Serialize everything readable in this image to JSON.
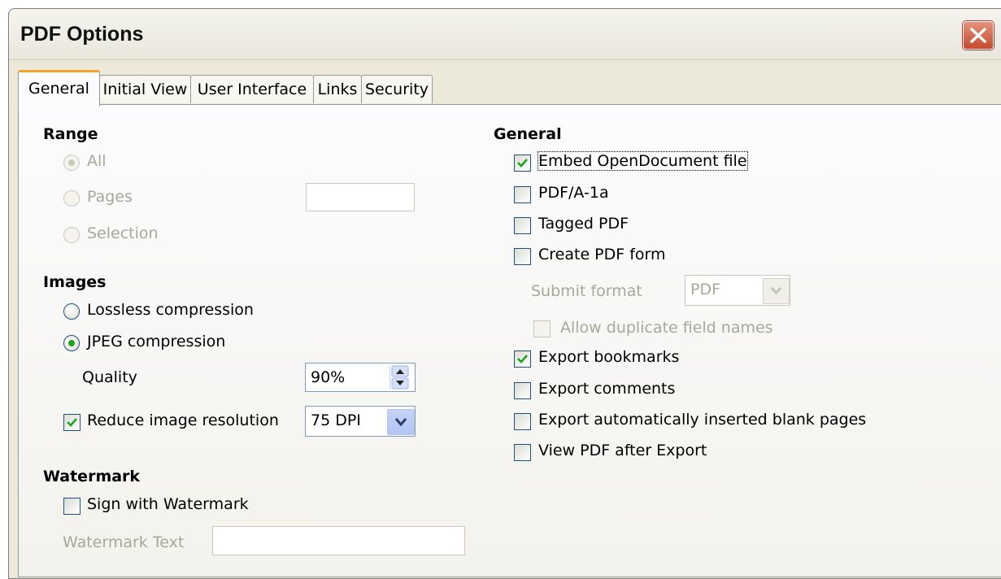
{
  "window": {
    "title": "PDF Options",
    "close_icon": "close-icon"
  },
  "tabs": [
    {
      "label": "General",
      "active": true
    },
    {
      "label": "Initial View",
      "active": false
    },
    {
      "label": "User Interface",
      "active": false
    },
    {
      "label": "Links",
      "active": false
    },
    {
      "label": "Security",
      "active": false
    }
  ],
  "range": {
    "header": "Range",
    "options": [
      {
        "label": "All",
        "selected": true,
        "enabled": false
      },
      {
        "label": "Pages",
        "selected": false,
        "enabled": false
      },
      {
        "label": "Selection",
        "selected": false,
        "enabled": false
      }
    ],
    "pages_value": ""
  },
  "images": {
    "header": "Images",
    "lossless_label": "Lossless compression",
    "jpeg_label": "JPEG compression",
    "selected": "jpeg",
    "quality_label": "Quality",
    "quality_value": "90%",
    "reduce_label": "Reduce image resolution",
    "reduce_checked": true,
    "resolution_value": "75 DPI"
  },
  "watermark": {
    "header": "Watermark",
    "sign_label": "Sign with Watermark",
    "sign_checked": false,
    "text_label": "Watermark Text",
    "text_value": ""
  },
  "general": {
    "header": "General",
    "embed_label": "Embed OpenDocument file",
    "embed_checked": true,
    "pdfa_label": "PDF/A-1a",
    "tagged_label": "Tagged PDF",
    "form_label": "Create PDF form",
    "submit_label": "Submit format",
    "submit_value": "PDF",
    "allow_dup_label": "Allow duplicate field names",
    "bookmarks_label": "Export bookmarks",
    "bookmarks_checked": true,
    "comments_label": "Export comments",
    "blank_label": "Export automatically inserted blank pages",
    "view_label": "View PDF after Export"
  },
  "colors": {
    "accent_tab": "#f4a22c",
    "check_green": "#21a121",
    "close_red": "#c34a2c"
  }
}
